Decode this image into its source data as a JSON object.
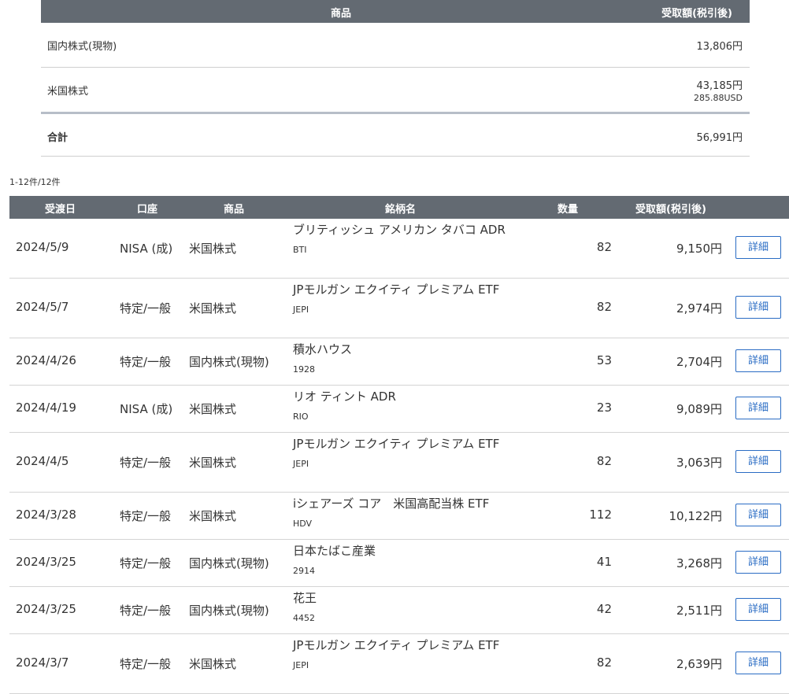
{
  "summary": {
    "header": {
      "product": "商品",
      "amount": "受取額(税引後)"
    },
    "rows": [
      {
        "label": "国内株式(現物)",
        "amount": "13,806円",
        "sub": ""
      },
      {
        "label": "米国株式",
        "amount": "43,185円",
        "sub": "285.88USD"
      }
    ],
    "total": {
      "label": "合計",
      "amount": "56,991円"
    }
  },
  "count_text": "1-12件/12件",
  "table": {
    "headers": {
      "date": "受渡日",
      "account": "口座",
      "product": "商品",
      "name": "銘柄名",
      "qty": "数量",
      "amount": "受取額(税引後)"
    },
    "button_label": "詳細",
    "rows": [
      {
        "date": "2024/5/9",
        "account": "NISA (成)",
        "product": "米国株式",
        "name": "ブリティッシュ アメリカン タバコ ADR",
        "code": "BTI",
        "qty": "82",
        "amount": "9,150円"
      },
      {
        "date": "2024/5/7",
        "account": "特定/一般",
        "product": "米国株式",
        "name": "JPモルガン エクイティ プレミアム ETF",
        "code": "JEPI",
        "qty": "82",
        "amount": "2,974円"
      },
      {
        "date": "2024/4/26",
        "account": "特定/一般",
        "product": "国内株式(現物)",
        "name": "積水ハウス",
        "code": "1928",
        "qty": "53",
        "amount": "2,704円"
      },
      {
        "date": "2024/4/19",
        "account": "NISA (成)",
        "product": "米国株式",
        "name": "リオ ティント ADR",
        "code": "RIO",
        "qty": "23",
        "amount": "9,089円"
      },
      {
        "date": "2024/4/5",
        "account": "特定/一般",
        "product": "米国株式",
        "name": "JPモルガン エクイティ プレミアム ETF",
        "code": "JEPI",
        "qty": "82",
        "amount": "3,063円"
      },
      {
        "date": "2024/3/28",
        "account": "特定/一般",
        "product": "米国株式",
        "name": "iシェアーズ コア　米国高配当株 ETF",
        "code": "HDV",
        "qty": "112",
        "amount": "10,122円"
      },
      {
        "date": "2024/3/25",
        "account": "特定/一般",
        "product": "国内株式(現物)",
        "name": "日本たばこ産業",
        "code": "2914",
        "qty": "41",
        "amount": "3,268円"
      },
      {
        "date": "2024/3/25",
        "account": "特定/一般",
        "product": "国内株式(現物)",
        "name": "花王",
        "code": "4452",
        "qty": "42",
        "amount": "2,511円"
      },
      {
        "date": "2024/3/7",
        "account": "特定/一般",
        "product": "米国株式",
        "name": "JPモルガン エクイティ プレミアム ETF",
        "code": "JEPI",
        "qty": "82",
        "amount": "2,639円"
      }
    ]
  }
}
